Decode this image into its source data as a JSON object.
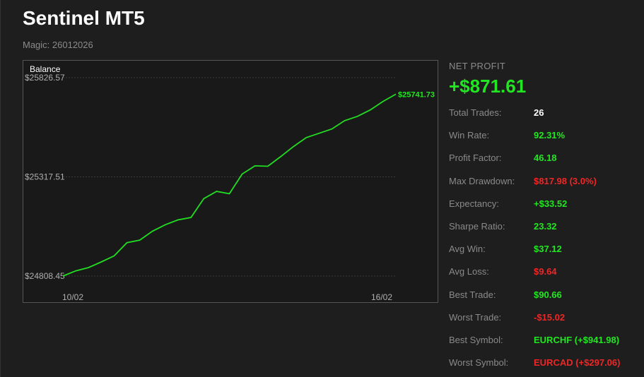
{
  "header": {
    "title": "Sentinel MT5",
    "subtitle": "Magic: 26012026"
  },
  "chart_data": {
    "type": "line",
    "title": "Balance",
    "x_tick_labels": [
      "10/02",
      "16/02"
    ],
    "y_tick_labels": [
      "$25826.57",
      "$25317.51",
      "$24808.45"
    ],
    "ylim": [
      24808.45,
      25826.57
    ],
    "grid": true,
    "end_label": "$25741.73",
    "series": [
      {
        "color": "#22dd22",
        "values": [
          24808.45,
          24835,
          24852,
          24881,
          24912,
          24980,
          24993,
          25039,
          25072,
          25097,
          25109,
          25206,
          25243,
          25231,
          25332,
          25374,
          25372,
          25421,
          25473,
          25519,
          25541,
          25563,
          25606,
          25628,
          25661,
          25705,
          25741.73
        ]
      }
    ]
  },
  "stats": {
    "net_profit_label": "NET PROFIT",
    "net_profit_value": "+$871.61",
    "rows": [
      {
        "label": "Total Trades:",
        "value": "26",
        "color": "white"
      },
      {
        "label": "Win Rate:",
        "value": "92.31%",
        "color": "green"
      },
      {
        "label": "Profit Factor:",
        "value": "46.18",
        "color": "green"
      },
      {
        "label": "Max Drawdown:",
        "value": "$817.98 (3.0%)",
        "color": "red"
      },
      {
        "label": "Expectancy:",
        "value": "+$33.52",
        "color": "green"
      },
      {
        "label": "Sharpe Ratio:",
        "value": "23.32",
        "color": "green"
      },
      {
        "label": "Avg Win:",
        "value": "$37.12",
        "color": "green"
      },
      {
        "label": "Avg Loss:",
        "value": "$9.64",
        "color": "red"
      },
      {
        "label": "Best Trade:",
        "value": "$90.66",
        "color": "green"
      },
      {
        "label": "Worst Trade:",
        "value": "-$15.02",
        "color": "red"
      },
      {
        "label": "Best Symbol:",
        "value": "EURCHF (+$941.98)",
        "color": "green"
      },
      {
        "label": "Worst Symbol:",
        "value": "EURCAD (+$297.06)",
        "color": "red"
      }
    ]
  }
}
